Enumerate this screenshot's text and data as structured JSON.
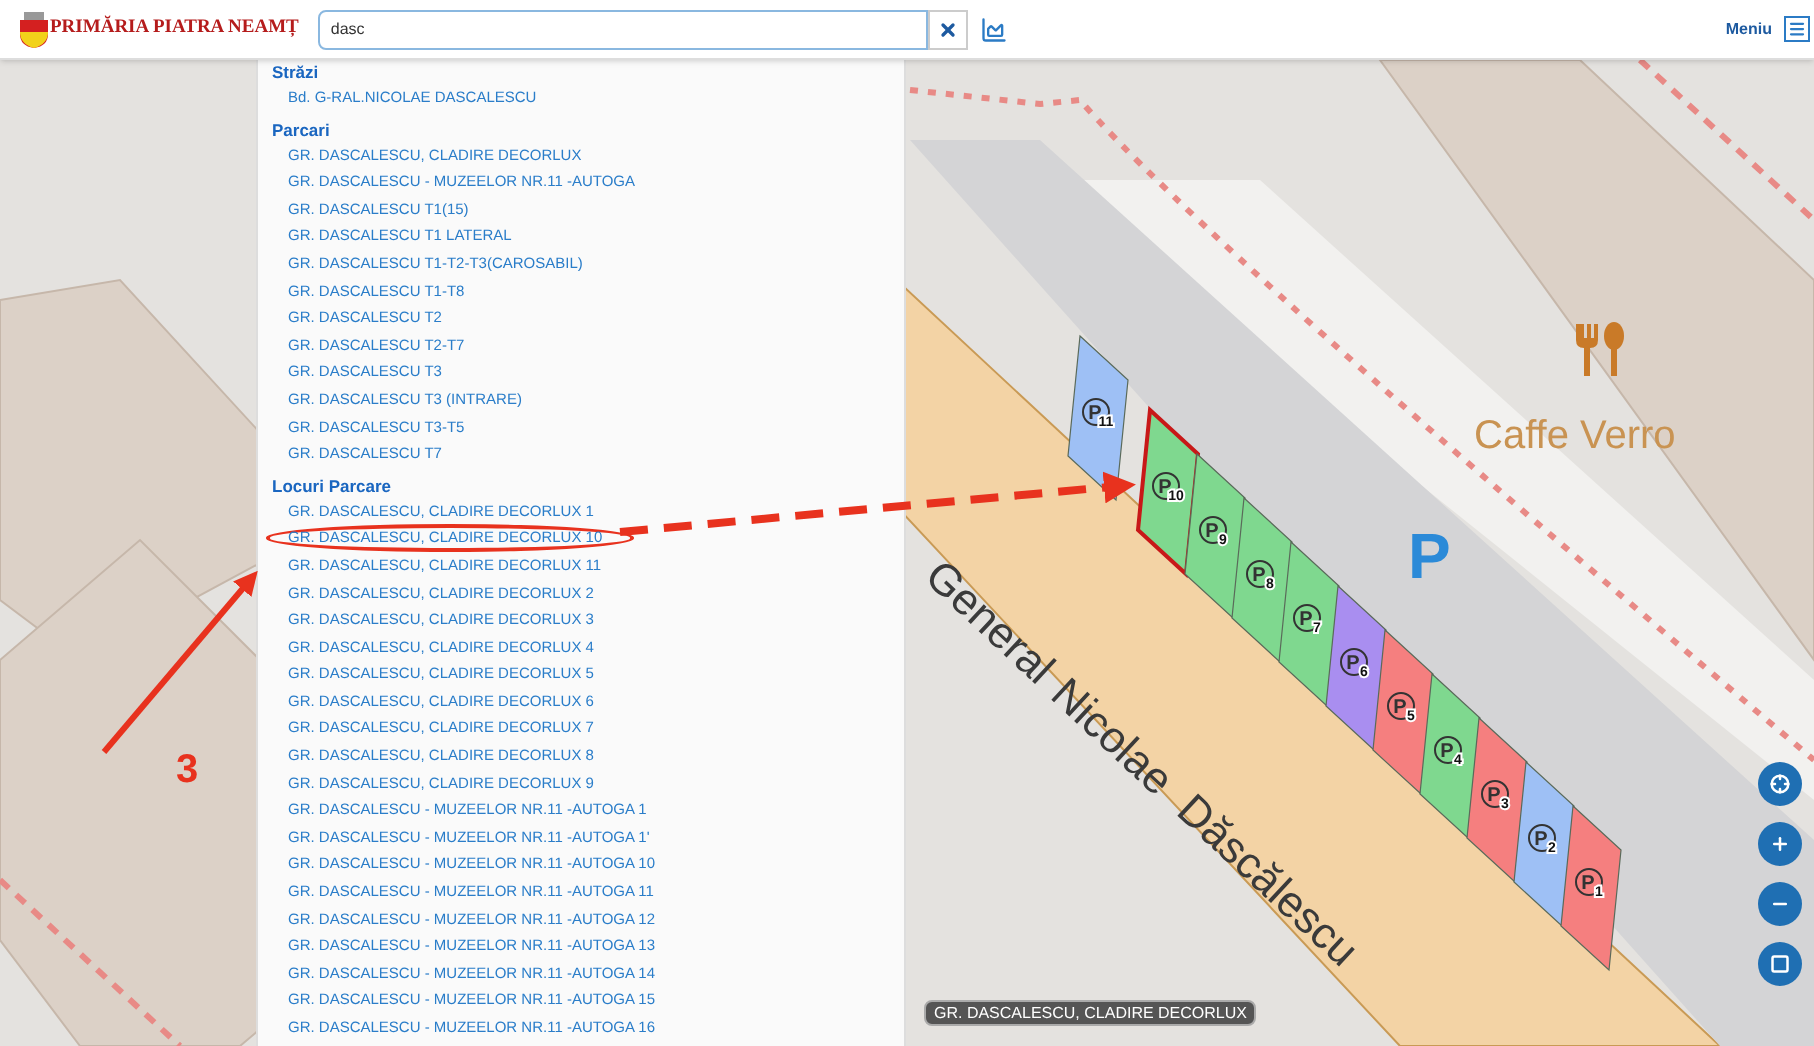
{
  "header": {
    "logo_text": "PRIMĂRIA PIATRA NEAMȚ",
    "search": {
      "value": "dasc"
    },
    "menu_label": "Meniu"
  },
  "results": [
    {
      "title": "Străzi",
      "items": [
        {
          "label": "Bd. G-RAL.NICOLAE DASCALESCU",
          "circled": false
        }
      ]
    },
    {
      "title": "Parcari",
      "items": [
        {
          "label": "GR. DASCALESCU, CLADIRE DECORLUX",
          "circled": false
        },
        {
          "label": "GR. DASCALESCU - MUZEELOR NR.11 -AUTOGA",
          "circled": false
        },
        {
          "label": "GR. DASCALESCU T1(15)",
          "circled": false
        },
        {
          "label": "GR. DASCALESCU T1 LATERAL",
          "circled": false
        },
        {
          "label": "GR. DASCALESCU T1-T2-T3(CAROSABIL)",
          "circled": false
        },
        {
          "label": "GR. DASCALESCU T1-T8",
          "circled": false
        },
        {
          "label": "GR. DASCALESCU T2",
          "circled": false
        },
        {
          "label": "GR. DASCALESCU T2-T7",
          "circled": false
        },
        {
          "label": "GR. DASCALESCU T3",
          "circled": false
        },
        {
          "label": "GR. DASCALESCU T3 (INTRARE)",
          "circled": false
        },
        {
          "label": "GR. DASCALESCU T3-T5",
          "circled": false
        },
        {
          "label": "GR. DASCALESCU T7",
          "circled": false
        }
      ]
    },
    {
      "title": "Locuri Parcare",
      "items": [
        {
          "label": "GR. DASCALESCU, CLADIRE DECORLUX 1",
          "circled": false
        },
        {
          "label": "GR. DASCALESCU, CLADIRE DECORLUX 10",
          "circled": true
        },
        {
          "label": "GR. DASCALESCU, CLADIRE DECORLUX 11",
          "circled": false
        },
        {
          "label": "GR. DASCALESCU, CLADIRE DECORLUX 2",
          "circled": false
        },
        {
          "label": "GR. DASCALESCU, CLADIRE DECORLUX 3",
          "circled": false
        },
        {
          "label": "GR. DASCALESCU, CLADIRE DECORLUX 4",
          "circled": false
        },
        {
          "label": "GR. DASCALESCU, CLADIRE DECORLUX 5",
          "circled": false
        },
        {
          "label": "GR. DASCALESCU, CLADIRE DECORLUX 6",
          "circled": false
        },
        {
          "label": "GR. DASCALESCU, CLADIRE DECORLUX 7",
          "circled": false
        },
        {
          "label": "GR. DASCALESCU, CLADIRE DECORLUX 8",
          "circled": false
        },
        {
          "label": "GR. DASCALESCU, CLADIRE DECORLUX 9",
          "circled": false
        },
        {
          "label": "GR. DASCALESCU - MUZEELOR NR.11 -AUTOGA 1",
          "circled": false
        },
        {
          "label": "GR. DASCALESCU - MUZEELOR NR.11 -AUTOGA 1'",
          "circled": false
        },
        {
          "label": "GR. DASCALESCU - MUZEELOR NR.11 -AUTOGA 10",
          "circled": false
        },
        {
          "label": "GR. DASCALESCU - MUZEELOR NR.11 -AUTOGA 11",
          "circled": false
        },
        {
          "label": "GR. DASCALESCU - MUZEELOR NR.11 -AUTOGA 12",
          "circled": false
        },
        {
          "label": "GR. DASCALESCU - MUZEELOR NR.11 -AUTOGA 13",
          "circled": false
        },
        {
          "label": "GR. DASCALESCU - MUZEELOR NR.11 -AUTOGA 14",
          "circled": false
        },
        {
          "label": "GR. DASCALESCU - MUZEELOR NR.11 -AUTOGA 15",
          "circled": false
        },
        {
          "label": "GR. DASCALESCU - MUZEELOR NR.11 -AUTOGA 16",
          "circled": false
        }
      ]
    }
  ],
  "map": {
    "street_label_words": [
      "General",
      "Nicolae",
      "Dăscălescu"
    ],
    "poi_label": "Caffe Verro",
    "parking_label": "P",
    "tooltip": "GR. DASCALESCU, CLADIRE DECORLUX",
    "spots": [
      {
        "symbol": "P",
        "number": "11",
        "color": "#9ec0f5",
        "selected": false
      },
      {
        "symbol": "P",
        "number": "10",
        "color": "#7fd88f",
        "selected": true
      },
      {
        "symbol": "P",
        "number": "9",
        "color": "#7fd88f",
        "selected": false
      },
      {
        "symbol": "P",
        "number": "8",
        "color": "#7fd88f",
        "selected": false
      },
      {
        "symbol": "P",
        "number": "7",
        "color": "#7fd88f",
        "selected": false
      },
      {
        "symbol": "P",
        "number": "6",
        "color": "#a98ef0",
        "selected": false
      },
      {
        "symbol": "P",
        "number": "5",
        "color": "#f57f7f",
        "selected": false
      },
      {
        "symbol": "P",
        "number": "4",
        "color": "#7fd88f",
        "selected": false
      },
      {
        "symbol": "P",
        "number": "3",
        "color": "#f57f7f",
        "selected": false
      },
      {
        "symbol": "P",
        "number": "2",
        "color": "#9ec0f5",
        "selected": false
      },
      {
        "symbol": "P",
        "number": "1",
        "color": "#f57f7f",
        "selected": false
      }
    ]
  },
  "annotation": {
    "label": "3"
  }
}
